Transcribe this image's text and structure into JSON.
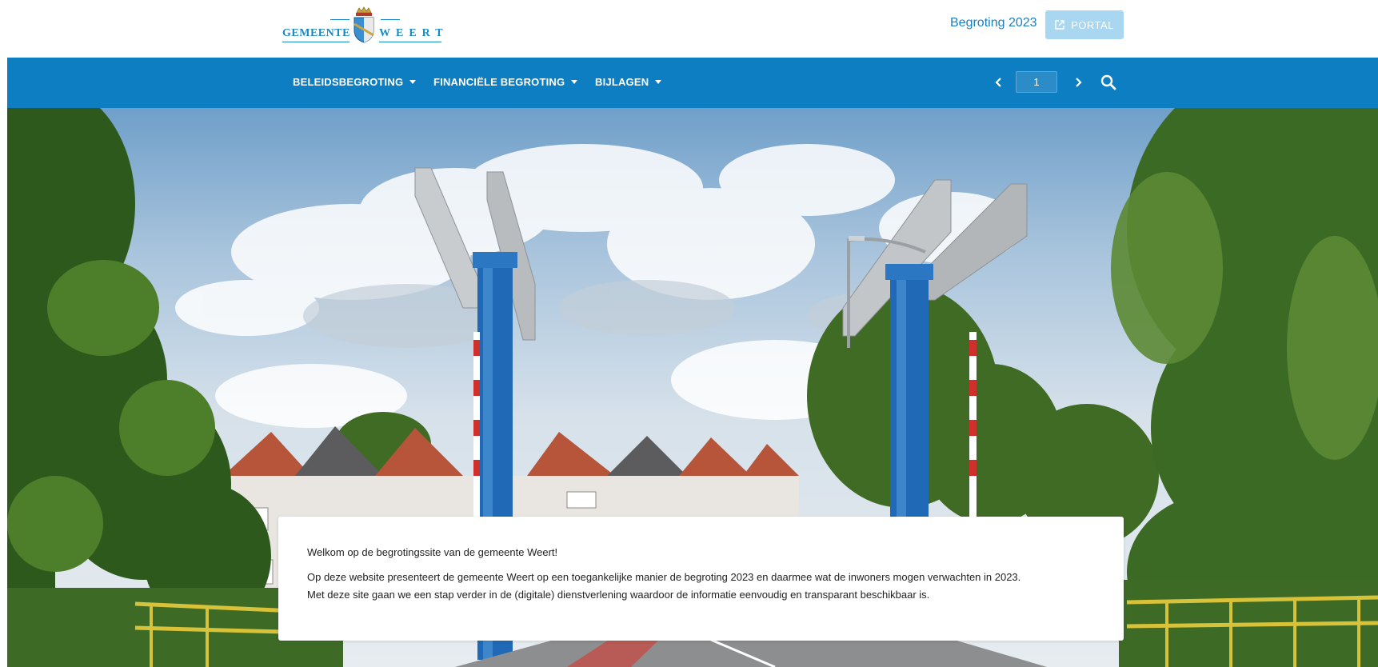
{
  "header": {
    "logo_left": "GEMEENTE",
    "logo_right": "WEERT",
    "budget_link": "Begroting 2023",
    "portal_label": "PORTAL"
  },
  "nav": {
    "items": [
      {
        "label": "BELEIDSBEGROTING"
      },
      {
        "label": "FINANCIËLE BEGROTING"
      },
      {
        "label": "BIJLAGEN"
      }
    ],
    "page_value": "1"
  },
  "card": {
    "welcome": "Welkom op de begrotingssite van de gemeente Weert!",
    "line1": "Op deze website presenteert de gemeente Weert op een toegankelijke manier de begroting 2023 en daarmee wat de inwoners mogen verwachten in 2023.",
    "line2": "Met deze site gaan we een stap verder in de (digitale) dienstverlening waardoor de informatie eenvoudig en transparant beschikbaar is."
  },
  "colors": {
    "brand_blue": "#0d7ec1",
    "link_blue": "#1a7fc0",
    "portal_bg": "#a9d7f1"
  },
  "icons": [
    "crest-icon",
    "external-link-icon",
    "chevron-down-icon",
    "chevron-left-icon",
    "chevron-right-icon",
    "search-icon"
  ]
}
